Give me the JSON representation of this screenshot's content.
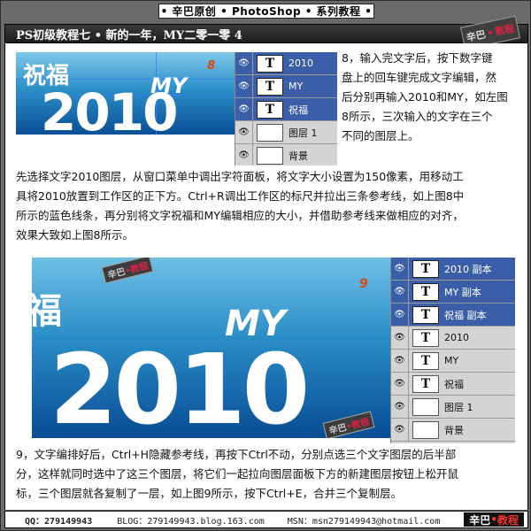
{
  "header": {
    "top_banner": "• 辛巴原创 • PhotoShop • 系列教程 •",
    "title": "PS初级教程七 • 新的一年，MY二零一零 4",
    "logo_text_a": "辛巴",
    "logo_text_b": "教程"
  },
  "figure8": {
    "label": "8",
    "line1": "祝福",
    "line2": "MY",
    "line3": "2010",
    "layers": [
      {
        "name": "2010",
        "type": "text",
        "selected": true
      },
      {
        "name": "MY",
        "type": "text",
        "selected": true
      },
      {
        "name": "祝福",
        "type": "text",
        "selected": true
      },
      {
        "name": "图层 1",
        "type": "image",
        "selected": false
      },
      {
        "name": "背景",
        "type": "image",
        "selected": false
      }
    ]
  },
  "figure9": {
    "label": "9",
    "line1": "福",
    "line2": "MY",
    "line3": "2010",
    "layers": [
      {
        "name": "2010 副本",
        "type": "text",
        "selected": true
      },
      {
        "name": "MY 副本",
        "type": "text",
        "selected": true
      },
      {
        "name": "祝福 副本",
        "type": "text",
        "selected": true
      },
      {
        "name": "2010",
        "type": "text",
        "selected": false
      },
      {
        "name": "MY",
        "type": "text",
        "selected": false
      },
      {
        "name": "祝福",
        "type": "text",
        "selected": false
      },
      {
        "name": "图层 1",
        "type": "image",
        "selected": false
      },
      {
        "name": "背景",
        "type": "image",
        "selected": false
      }
    ]
  },
  "paragraphs": {
    "p8_lines": [
      "8，输入完文字后，按下数字键",
      "盘上的回车键完成文字编辑，然",
      "后分别再输入2010和MY，如左图",
      "8所示，三次输入的文字在三个",
      "不同的图层上。"
    ],
    "p_mid_lines": [
      "先选择文字2010图层，从窗口菜单中调出字符面板，将文字大小设置为150像素，用移动工",
      "具将2010放置到工作区的正下方。Ctrl+R调出工作区的标尺并拉出三条参考线，如上图8中",
      "所示的蓝色线条，再分别将文字祝福和MY编辑相应的大小，并借助参考线来做相应的对齐，",
      "效果大致如上图8所示。"
    ],
    "p9_lines": [
      "9，文字编排好后，Ctrl+H隐藏参考线，再按下Ctrl不动，分别点选三个文字图层的后半部",
      "分，这样就同时选中了这三个图层，将它们一起拉向图层面板下方的新建图层按钮上松开鼠",
      "标，三个图层就各复制了一层，如上图9所示，按下Ctrl+E，合并三个复制层。"
    ]
  },
  "footer": {
    "qq": "QQ：279149943",
    "blog": "BLOG：279149943.blog.163.com",
    "msn": "MSN：msn279149943@hotmail.com",
    "logo_a": "辛巴",
    "logo_b": "教程"
  },
  "colors": {
    "selected_layer": "#3a5fa8",
    "accent_red": "#d41"
  }
}
